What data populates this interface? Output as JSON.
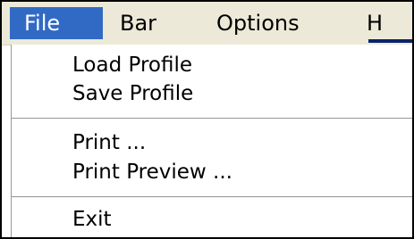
{
  "menubar": {
    "items": [
      {
        "label": "File"
      },
      {
        "label": "Bar"
      },
      {
        "label": "Options"
      },
      {
        "label": "H"
      }
    ]
  },
  "file_menu": {
    "items": [
      {
        "label": "Load Profile"
      },
      {
        "label": "Save Profile"
      },
      {
        "label": "Print ..."
      },
      {
        "label": "Print Preview ..."
      },
      {
        "label": "Exit"
      }
    ]
  },
  "colors": {
    "menubar_bg": "#ece9d8",
    "selected_bg": "#316ac5",
    "selected_fg": "#ffffff"
  }
}
